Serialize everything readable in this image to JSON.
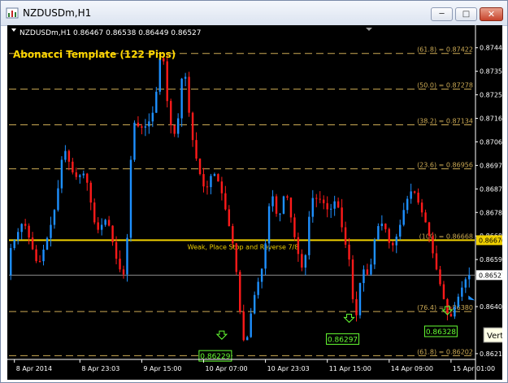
{
  "window": {
    "title": "NZDUSDm,H1",
    "min_icon": "minimize-icon",
    "max_icon": "maximize-icon",
    "close_icon": "close-icon"
  },
  "chart_header": {
    "symbol_info": "NZDUSDm,H1  0.86467 0.86538 0.86449 0.86527"
  },
  "template_label": "Abonacci Template (122 Pips)",
  "colors": {
    "background": "#000000",
    "bull": "#1e90ff",
    "bear": "#ff1a1a",
    "fib_line": "#ccaa55",
    "key_line": "#f0d000",
    "label_green": "#66ff33",
    "axis_text": "#ffffff",
    "template_text": "#ffd700"
  },
  "fib_levels": [
    {
      "label": "(61.8) = 0.87422",
      "price": 0.87422
    },
    {
      "label": "(50.0) = 0.87278",
      "price": 0.87278
    },
    {
      "label": "(38.2) = 0.87134",
      "price": 0.87134
    },
    {
      "label": "(23.6) = 0.86956",
      "price": 0.86956
    },
    {
      "label": "(100) = 0.86668",
      "price": 0.86668
    },
    {
      "label": "(76.4) = 0.86380",
      "price": 0.8638
    },
    {
      "label": "(61.8) = 0.86202",
      "price": 0.86202
    }
  ],
  "key_level": {
    "price": 0.86668,
    "price_tag": "0.86670",
    "note": "Weak, Place Stop and Reverse  7/8"
  },
  "current_price": {
    "price": 0.86527,
    "tag": "0.86527"
  },
  "price_axis": [
    {
      "label": "0.87445",
      "price": 0.87445
    },
    {
      "label": "0.87350",
      "price": 0.8735
    },
    {
      "label": "0.87255",
      "price": 0.87255
    },
    {
      "label": "0.87160",
      "price": 0.8716
    },
    {
      "label": "0.87065",
      "price": 0.87065
    },
    {
      "label": "0.86970",
      "price": 0.8697
    },
    {
      "label": "0.86875",
      "price": 0.86875
    },
    {
      "label": "0.86780",
      "price": 0.8678
    },
    {
      "label": "0.86685",
      "price": 0.86685
    },
    {
      "label": "0.86590",
      "price": 0.8659
    },
    {
      "label": "0.86400",
      "price": 0.864
    },
    {
      "label": "0.86210",
      "price": 0.8621
    }
  ],
  "time_axis": [
    {
      "label": "8 Apr 2014",
      "bar": 1
    },
    {
      "label": "8 Apr 23:03",
      "bar": 19
    },
    {
      "label": "9 Apr 15:00",
      "bar": 36
    },
    {
      "label": "10 Apr 07:00",
      "bar": 53
    },
    {
      "label": "10 Apr 23:03",
      "bar": 70
    },
    {
      "label": "11 Apr 15:00",
      "bar": 87
    },
    {
      "label": "14 Apr 09:00",
      "bar": 104
    },
    {
      "label": "15 Apr 01:00",
      "bar": 121
    }
  ],
  "swing_labels": [
    {
      "text": "0.86229",
      "bar": 58,
      "price": 0.86229
    },
    {
      "text": "0.86297",
      "bar": 93,
      "price": 0.86297
    },
    {
      "text": "0.86328",
      "bar": 120,
      "price": 0.86328
    }
  ],
  "tooltip_text": "Vertic",
  "chart_data": {
    "type": "candlestick",
    "ylim": [
      0.8619,
      0.8749
    ],
    "close_path": [
      [
        0,
        0.8662
      ],
      [
        4,
        0.8675
      ],
      [
        8,
        0.8656
      ],
      [
        11,
        0.867
      ],
      [
        13,
        0.8682
      ],
      [
        15,
        0.8705
      ],
      [
        18,
        0.8692
      ],
      [
        21,
        0.8694
      ],
      [
        24,
        0.867
      ],
      [
        27,
        0.8676
      ],
      [
        30,
        0.8656
      ],
      [
        32,
        0.8652
      ],
      [
        34,
        0.8715
      ],
      [
        36,
        0.8712
      ],
      [
        38,
        0.8713
      ],
      [
        40,
        0.872
      ],
      [
        42,
        0.8747
      ],
      [
        44,
        0.8715
      ],
      [
        46,
        0.8708
      ],
      [
        48,
        0.874
      ],
      [
        50,
        0.8711
      ],
      [
        52,
        0.8696
      ],
      [
        54,
        0.8686
      ],
      [
        56,
        0.8695
      ],
      [
        58,
        0.8689
      ],
      [
        60,
        0.8676
      ],
      [
        62,
        0.8662
      ],
      [
        64,
        0.863
      ],
      [
        65,
        0.86229
      ],
      [
        67,
        0.8642
      ],
      [
        70,
        0.8658
      ],
      [
        72,
        0.8688
      ],
      [
        74,
        0.8674
      ],
      [
        76,
        0.8688
      ],
      [
        79,
        0.8664
      ],
      [
        81,
        0.8653
      ],
      [
        83,
        0.8684
      ],
      [
        86,
        0.8683
      ],
      [
        88,
        0.8678
      ],
      [
        90,
        0.8684
      ],
      [
        92,
        0.8668
      ],
      [
        94,
        0.8656
      ],
      [
        95,
        0.863
      ],
      [
        97,
        0.8656
      ],
      [
        99,
        0.8652
      ],
      [
        101,
        0.8672
      ],
      [
        103,
        0.8674
      ],
      [
        105,
        0.8663
      ],
      [
        107,
        0.867
      ],
      [
        109,
        0.8682
      ],
      [
        111,
        0.8688
      ],
      [
        113,
        0.868
      ],
      [
        115,
        0.8672
      ],
      [
        117,
        0.8658
      ],
      [
        119,
        0.8646
      ],
      [
        121,
        0.8634
      ],
      [
        122,
        0.8638
      ],
      [
        124,
        0.8646
      ],
      [
        126,
        0.86527
      ]
    ]
  }
}
